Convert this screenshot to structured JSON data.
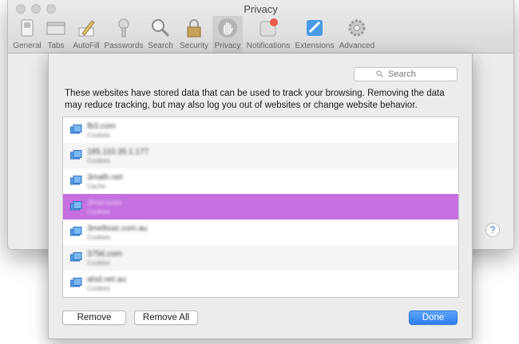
{
  "window": {
    "title": "Privacy"
  },
  "toolbar": {
    "items": [
      {
        "label": "General",
        "icon": "general-switch-icon"
      },
      {
        "label": "Tabs",
        "icon": "tabs-icon"
      },
      {
        "label": "AutoFill",
        "icon": "autofill-pencil-icon"
      },
      {
        "label": "Passwords",
        "icon": "key-icon"
      },
      {
        "label": "Search",
        "icon": "magnifier-icon"
      },
      {
        "label": "Security",
        "icon": "lock-icon"
      },
      {
        "label": "Privacy",
        "icon": "hand-icon",
        "active": true
      },
      {
        "label": "Notifications",
        "icon": "notifications-icon"
      },
      {
        "label": "Extensions",
        "icon": "extensions-icon"
      },
      {
        "label": "Advanced",
        "icon": "gear-icon"
      }
    ]
  },
  "help": {
    "label": "?"
  },
  "sheet": {
    "search": {
      "placeholder": "Search",
      "value": ""
    },
    "description": "These websites have stored data that can be used to track your browsing. Removing the data may reduce tracking, but may also log you out of websites or change website behavior.",
    "sites": [
      {
        "name": "fb3.com",
        "detail": "Cookies"
      },
      {
        "name": "185.110.35.1.177",
        "detail": "Cookies"
      },
      {
        "name": "3math.net",
        "detail": "Cache"
      },
      {
        "name": "2hse.com",
        "detail": "Cookies",
        "selected": true
      },
      {
        "name": "3meltsse.com.au",
        "detail": "Cookies"
      },
      {
        "name": "3756.com",
        "detail": "Cookies"
      },
      {
        "name": "alsd.net.au",
        "detail": "Cookies"
      }
    ],
    "buttons": {
      "remove": "Remove",
      "remove_all": "Remove All",
      "done": "Done"
    }
  },
  "colors": {
    "selection": "#c56fe0",
    "primary_button": "#2f7ff0"
  }
}
